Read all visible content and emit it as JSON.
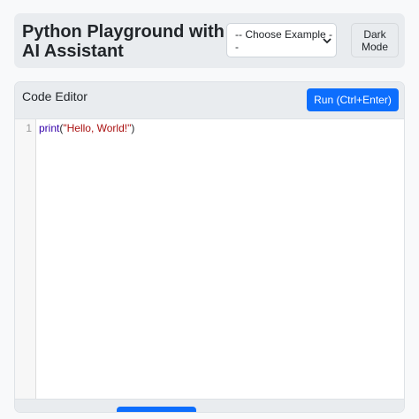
{
  "header": {
    "title": "Python Playground with AI Assistant",
    "example_select": {
      "selected": "-- Choose Example --"
    },
    "dark_mode_label_line1": "Dark",
    "dark_mode_label_line2": "Mode"
  },
  "editor": {
    "title": "Code Editor",
    "run_label": "Run (Ctrl+Enter)",
    "line_numbers": [
      "1"
    ],
    "code": {
      "func": "print",
      "open": "(",
      "string": "\"Hello, World!\"",
      "close": ")"
    }
  },
  "colors": {
    "accent": "#0d6efd",
    "header_bg": "#e9ecef",
    "keyword": "#3300aa",
    "string": "#aa1111"
  },
  "icons": {
    "select_arrow": "chevron-down-icon"
  }
}
